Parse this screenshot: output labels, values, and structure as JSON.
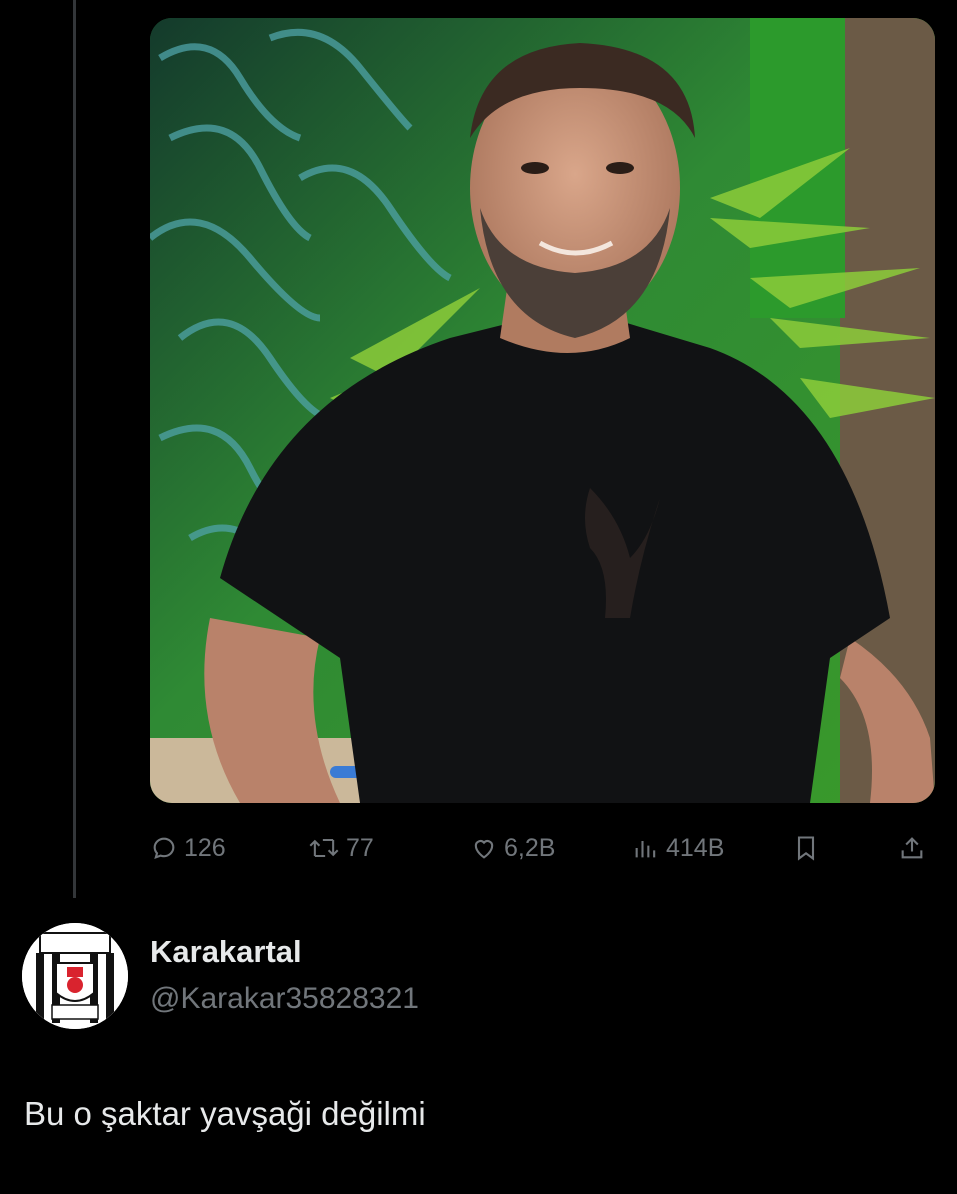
{
  "media": {
    "icon": "photo-of-smiling-man-in-black-tshirt"
  },
  "actions": {
    "reply_count": "126",
    "retweet_count": "77",
    "like_count": "6,2B",
    "view_count": "414B",
    "icons": [
      "reply-icon",
      "retweet-icon",
      "like-icon",
      "views-icon",
      "bookmark-icon",
      "share-icon"
    ]
  },
  "reply": {
    "display_name": "Karakartal",
    "handle": "@Karakar35828321",
    "text": "Bu o şaktar yavşaği değilmi",
    "avatar_icon": "bjk-crest-icon"
  },
  "colors": {
    "background": "#000000",
    "text_primary": "#e7e9ea",
    "text_secondary": "#71767b",
    "thread_line": "#333639"
  }
}
